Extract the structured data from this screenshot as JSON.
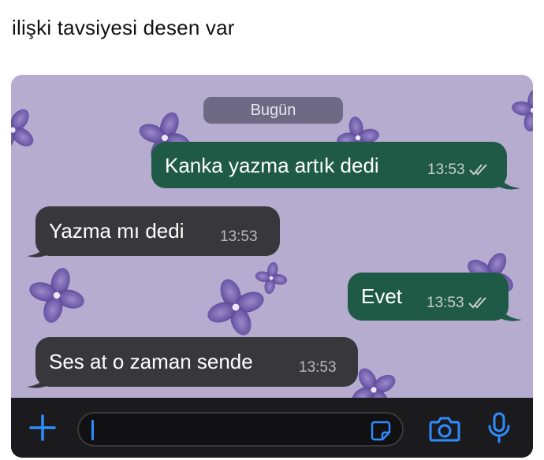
{
  "post": {
    "caption": "ilişki tavsiyesi desen var"
  },
  "chat": {
    "date_label": "Bugün",
    "messages": [
      {
        "direction": "outgoing",
        "text": "Kanka yazma artık dedi",
        "time": "13:53",
        "status": "read"
      },
      {
        "direction": "incoming",
        "text": "Yazma mı dedi",
        "time": "13:53"
      },
      {
        "direction": "outgoing",
        "text": "Evet",
        "time": "13:53",
        "status": "read"
      },
      {
        "direction": "incoming",
        "text": "Ses at o zaman sende",
        "time": "13:53"
      }
    ]
  },
  "input_bar": {
    "attach_icon": "plus-icon",
    "message_value": "",
    "sticker_icon": "sticker-icon",
    "camera_icon": "camera-icon",
    "mic_icon": "microphone-icon"
  },
  "colors": {
    "wallpaper": "#b5acd0",
    "outgoing_bubble": "#1f5a46",
    "incoming_bubble": "#38383c",
    "accent": "#2f8cff",
    "flower": "#6d59a8"
  }
}
